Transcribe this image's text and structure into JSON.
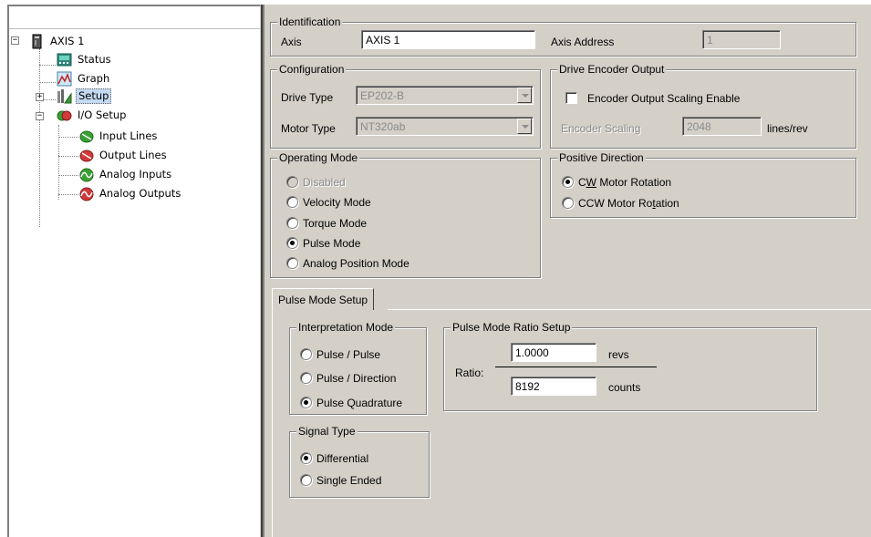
{
  "tree": {
    "items": [
      {
        "label": "AXIS 1",
        "icon": "drive-icon"
      },
      {
        "label": "Status",
        "icon": "status-icon"
      },
      {
        "label": "Graph",
        "icon": "graph-icon"
      },
      {
        "label": "Setup",
        "icon": "setup-icon"
      },
      {
        "label": "I/O Setup",
        "icon": "io-icon"
      },
      {
        "label": "Input Lines",
        "icon": "input-lines-icon"
      },
      {
        "label": "Output Lines",
        "icon": "output-lines-icon"
      },
      {
        "label": "Analog Inputs",
        "icon": "analog-inputs-icon"
      },
      {
        "label": "Analog Outputs",
        "icon": "analog-outputs-icon"
      }
    ],
    "expanders": {
      "axis": "−",
      "setup": "+",
      "io": "−"
    }
  },
  "identification": {
    "title": "Identification",
    "axis_label": "Axis",
    "axis_value": "AXIS 1",
    "address_label": "Axis Address",
    "address_value": "1"
  },
  "configuration": {
    "title": "Configuration",
    "drive_type_label": "Drive Type",
    "drive_type_value": "EP202-B",
    "motor_type_label": "Motor Type",
    "motor_type_value": "NT320ab"
  },
  "encoder_output": {
    "title": "Drive Encoder Output",
    "checkbox_label": "Encoder Output Scaling Enable",
    "checked": false,
    "scaling_label": "Encoder Scaling",
    "scaling_value": "2048",
    "scaling_unit": "lines/rev"
  },
  "operating_mode": {
    "title": "Operating Mode",
    "options": [
      "Disabled",
      "Velocity Mode",
      "Torque Mode",
      "Pulse Mode",
      "Analog Position Mode"
    ],
    "selected": "Pulse Mode"
  },
  "positive_direction": {
    "title": "Positive Direction",
    "options": [
      {
        "pre": "C",
        "ul": "W",
        "post": " Motor Rotation"
      },
      {
        "pre": "CCW Motor Ro",
        "ul": "t",
        "post": "ation"
      }
    ],
    "selected_index": 0
  },
  "pulse_tab": {
    "label": "Pulse Mode Setup"
  },
  "interpretation_mode": {
    "title": "Interpretation Mode",
    "options": [
      "Pulse / Pulse",
      "Pulse / Direction",
      "Pulse Quadrature"
    ],
    "selected": "Pulse Quadrature"
  },
  "ratio_setup": {
    "title": "Pulse Mode Ratio Setup",
    "ratio_label": "Ratio:",
    "numerator_value": "1.0000",
    "numerator_unit": "revs",
    "denominator_value": "8192",
    "denominator_unit": "counts"
  },
  "signal_type": {
    "title": "Signal Type",
    "options": [
      "Differential",
      "Single Ended"
    ],
    "selected": "Differential"
  }
}
